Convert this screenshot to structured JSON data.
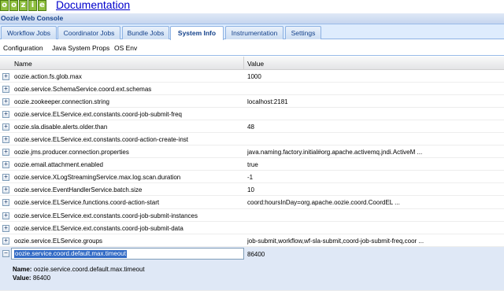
{
  "logo_letters": [
    "o",
    "o",
    "z",
    "i",
    "e"
  ],
  "doc_link": "Documentation",
  "console_title": "Oozie Web Console",
  "tabs": [
    "Workflow Jobs",
    "Coordinator Jobs",
    "Bundle Jobs",
    "System Info",
    "Instrumentation",
    "Settings"
  ],
  "active_tab": "System Info",
  "subtabs": [
    "Configuration",
    "Java System Props",
    "OS Env"
  ],
  "columns": {
    "name": "Name",
    "value": "Value"
  },
  "rows": [
    {
      "name": "oozie.action.fs.glob.max",
      "value": "1000"
    },
    {
      "name": "oozie.service.SchemaService.coord.ext.schemas",
      "value": ""
    },
    {
      "name": "oozie.zookeeper.connection.string",
      "value": "localhost:2181"
    },
    {
      "name": "oozie.service.ELService.ext.constants.coord-job-submit-freq",
      "value": ""
    },
    {
      "name": "oozie.sla.disable.alerts.older.than",
      "value": "48"
    },
    {
      "name": "oozie.service.ELService.ext.constants.coord-action-create-inst",
      "value": ""
    },
    {
      "name": "oozie.jms.producer.connection.properties",
      "value": "java.naming.factory.initial#org.apache.activemq.jndi.ActiveM ..."
    },
    {
      "name": "oozie.email.attachment.enabled",
      "value": "true"
    },
    {
      "name": "oozie.service.XLogStreamingService.max.log.scan.duration",
      "value": "-1"
    },
    {
      "name": "oozie.service.EventHandlerService.batch.size",
      "value": "10"
    },
    {
      "name": "oozie.service.ELService.functions.coord-action-start",
      "value": "coord:hoursInDay=org.apache.oozie.coord.CoordEL ..."
    },
    {
      "name": "oozie.service.ELService.ext.constants.coord-job-submit-instances",
      "value": ""
    },
    {
      "name": "oozie.service.ELService.ext.constants.coord-job-submit-data",
      "value": ""
    },
    {
      "name": "oozie.service.ELService.groups",
      "value": "job-submit,workflow,wf-sla-submit,coord-job-submit-freq,coor ..."
    }
  ],
  "expanded_row": {
    "name": "oozie.service.coord.default.max.timeout",
    "value": "86400",
    "detail_name_label": "Name:",
    "detail_value_label": "Value:"
  },
  "expander_collapsed": "+",
  "expander_expanded": "−"
}
